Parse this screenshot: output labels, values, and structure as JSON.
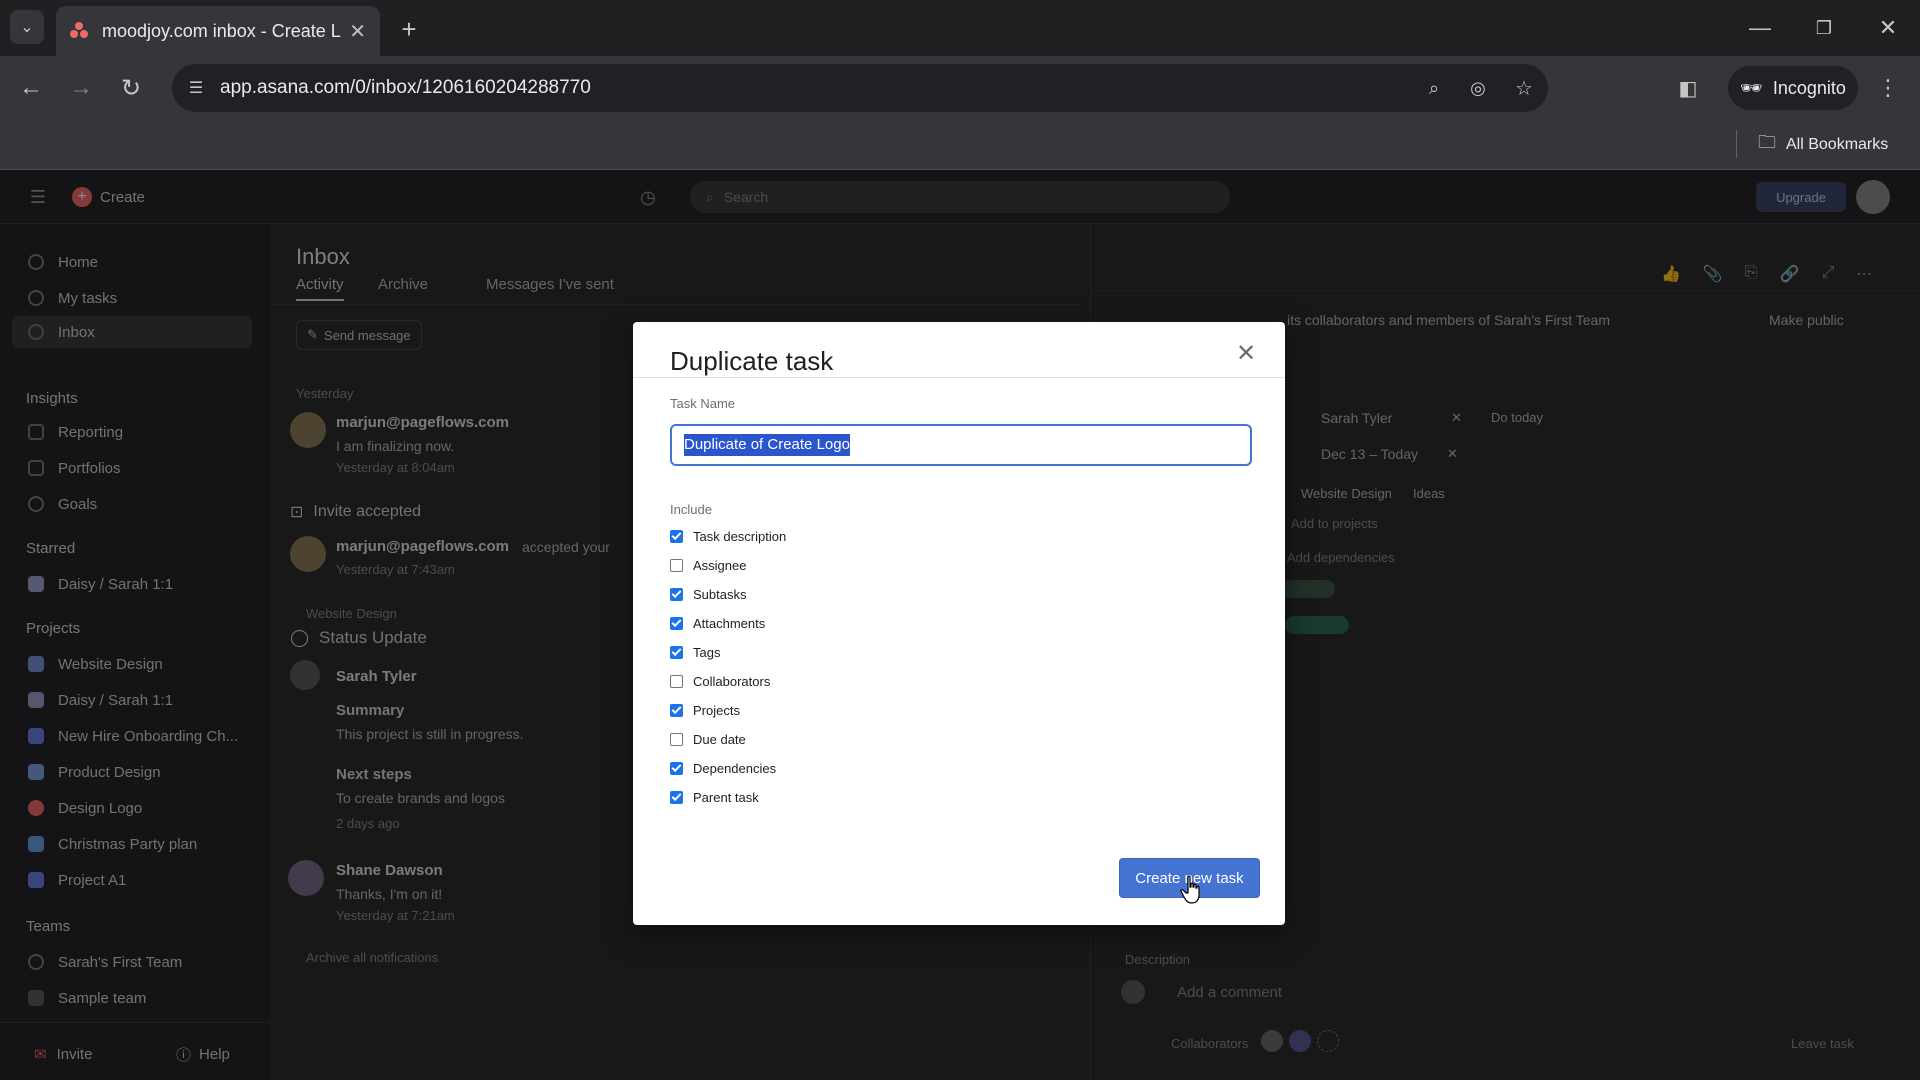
{
  "browser": {
    "tab_title": "moodjoy.com inbox - Create Lo",
    "url": "app.asana.com/0/inbox/1206160204288770",
    "profile_label": "Incognito",
    "bookmarks_label": "All Bookmarks"
  },
  "topnav": {
    "create_label": "Create",
    "search_placeholder": "Search",
    "upgrade_label": "Upgrade"
  },
  "sidebar": {
    "nav": [
      "Home",
      "My tasks",
      "Inbox"
    ],
    "insights_heading": "Insights",
    "insights": [
      "Reporting",
      "Portfolios",
      "Goals"
    ],
    "starred_heading": "Starred",
    "starred": [
      "Daisy / Sarah 1:1"
    ],
    "projects_heading": "Projects",
    "projects": [
      {
        "name": "Website Design",
        "color": "#7a8fd6"
      },
      {
        "name": "Daisy / Sarah 1:1",
        "color": "#9aa0c8"
      },
      {
        "name": "New Hire Onboarding Ch...",
        "color": "#6a7fe0"
      },
      {
        "name": "Product Design",
        "color": "#7aa0e0"
      },
      {
        "name": "Design Logo",
        "color": "#f06a6a"
      },
      {
        "name": "Christmas Party plan",
        "color": "#6a9fe0"
      },
      {
        "name": "Project A1",
        "color": "#6a7fe0"
      }
    ],
    "teams_heading": "Teams",
    "teams": [
      "Sarah's First Team",
      "Sample team"
    ],
    "invite_label": "Invite",
    "help_label": "Help"
  },
  "inbox": {
    "title": "Inbox",
    "tabs": [
      "Activity",
      "Archive",
      "Messages I've sent"
    ],
    "send_message_label": "Send message",
    "yesterday_label": "Yesterday",
    "items": [
      {
        "sender": "marjun@pageflows.com",
        "text": "I am finalizing now.",
        "time": "Yesterday at 8:04am"
      },
      {
        "heading": "Invite accepted",
        "sender": "marjun@pageflows.com",
        "text": "accepted your",
        "time": "Yesterday at 7:43am"
      },
      {
        "project": "Website Design",
        "heading": "Status Update",
        "sender": "Sarah Tyler",
        "summary_label": "Summary",
        "summary": "This project is still in progress.",
        "next_label": "Next steps",
        "next": "To create brands and logos",
        "time": "2 days ago"
      },
      {
        "sender": "Shane Dawson",
        "text": "Thanks, I'm on it!",
        "time": "Yesterday at 7:21am"
      }
    ],
    "archive_all_label": "Archive all notifications"
  },
  "task_pane": {
    "visibility_text": "its collaborators and members of Sarah's First Team",
    "make_public_label": "Make public",
    "assignee": "Sarah Tyler",
    "due_label": "Do today",
    "dates": "Dec 13 – Today",
    "project": "Website Design",
    "project_section": "Ideas",
    "add_to_projects": "Add to projects",
    "add_dependencies": "Add dependencies",
    "description_label": "Description",
    "comment_placeholder": "Add a comment",
    "collaborators_label": "Collaborators",
    "leave_task_label": "Leave task"
  },
  "dialog": {
    "title": "Duplicate task",
    "task_name_label": "Task Name",
    "task_name_value": "Duplicate of Create Logo",
    "include_label": "Include",
    "options": [
      {
        "label": "Task description",
        "checked": true
      },
      {
        "label": "Assignee",
        "checked": false
      },
      {
        "label": "Subtasks",
        "checked": true
      },
      {
        "label": "Attachments",
        "checked": true
      },
      {
        "label": "Tags",
        "checked": true
      },
      {
        "label": "Collaborators",
        "checked": false
      },
      {
        "label": "Projects",
        "checked": true
      },
      {
        "label": "Due date",
        "checked": false
      },
      {
        "label": "Dependencies",
        "checked": true
      },
      {
        "label": "Parent task",
        "checked": true
      }
    ],
    "create_button_label": "Create new task"
  },
  "colors": {
    "accent": "#4573d2",
    "checkbox": "#1a73e8",
    "brand": "#f06a6a"
  }
}
